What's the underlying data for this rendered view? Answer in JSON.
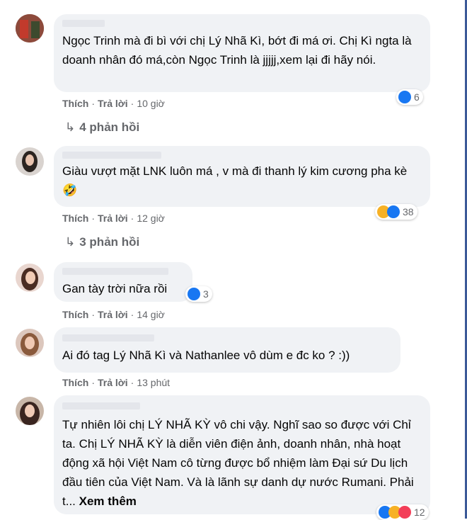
{
  "comments": [
    {
      "text": "Ngọc Trinh mà đi bì với chị Lý Nhã Kì, bớt đi má ơi. Chị Kì ngta là doanh nhân đó má,còn Ngọc Trinh là jjjjj,xem lại đi hãy nói.",
      "like_label": "Thích",
      "reply_label": "Trả lời",
      "time": "10 giờ",
      "reaction_count": "6",
      "replies": "4 phản hồi"
    },
    {
      "text": "Giàu vượt mặt LNK luôn má , v mà đi thanh lý kim cương pha kè 🤣",
      "like_label": "Thích",
      "reply_label": "Trả lời",
      "time": "12 giờ",
      "reaction_count": "38",
      "replies": "3 phản hồi"
    },
    {
      "text": "Gan tày trời nữa rồi",
      "like_label": "Thích",
      "reply_label": "Trả lời",
      "time": "14 giờ",
      "reaction_count": "3"
    },
    {
      "text": "Ai đó tag Lý Nhã Kì và Nathanlee vô dùm e đc ko ? :))",
      "like_label": "Thích",
      "reply_label": "Trả lời",
      "time": "13 phút"
    },
    {
      "text": "Tự nhiên lôi chị LÝ NHÃ KỲ vô chi vậy. Nghĩ sao so được với Chỉ ta. Chị LÝ NHÃ KỲ là diễn viên điện ảnh, doanh nhân, nhà hoạt động xã hội Việt Nam cô từng được bổ nhiệm làm Đại sứ Du lịch đầu tiên của Việt Nam. Và là lãnh sự danh dự nước Rumani. Phải t...",
      "see_more": "Xem thêm",
      "reaction_count": "12"
    }
  ],
  "colors": {
    "bubble": "#f0f2f5",
    "meta": "#65676b",
    "like_blue": "#1877f2",
    "haha_yellow": "#f7b125",
    "love_red": "#f33e58"
  }
}
